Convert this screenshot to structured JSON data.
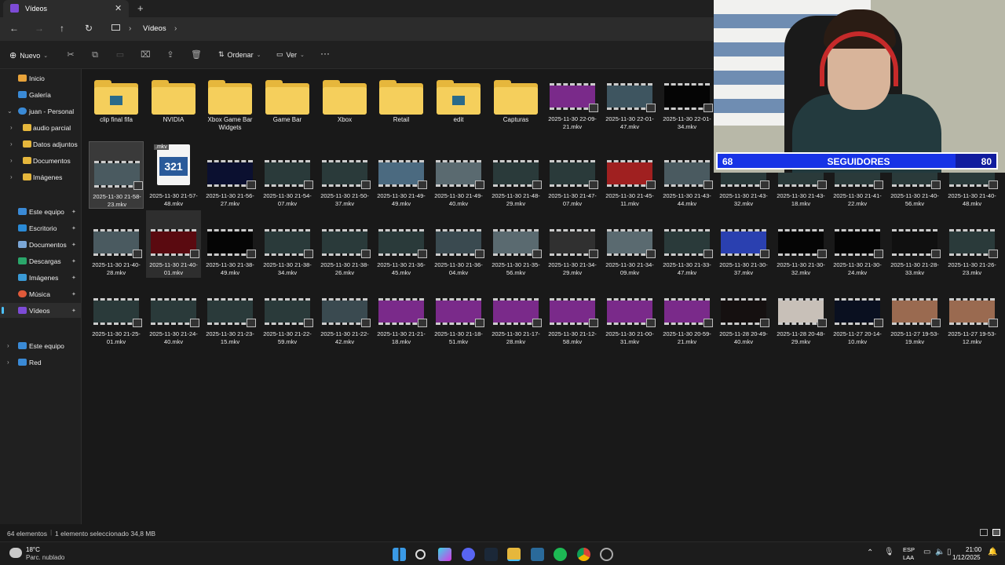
{
  "window": {
    "tab_title": "Vídeos",
    "close": "✕",
    "new_tab": "+"
  },
  "nav": {
    "location": "Vídeos"
  },
  "commands": {
    "new": "Nuevo",
    "sort": "Ordenar",
    "view": "Ver",
    "more": "···"
  },
  "sidebar": {
    "items": [
      {
        "label": "Inicio",
        "icon": "home-icon"
      },
      {
        "label": "Galería",
        "icon": "gallery-icon"
      },
      {
        "label": "juan - Personal",
        "icon": "cloud-icon"
      },
      {
        "label": "audio parcial",
        "icon": "folder-icon"
      },
      {
        "label": "Datos adjuntos",
        "icon": "folder-icon"
      },
      {
        "label": "Documentos",
        "icon": "folder-icon"
      },
      {
        "label": "Imágenes",
        "icon": "folder-icon"
      },
      {
        "label": "Este equipo",
        "icon": "monitor-icon"
      },
      {
        "label": "Escritorio",
        "icon": "desktop-icon"
      },
      {
        "label": "Documentos",
        "icon": "documents-icon"
      },
      {
        "label": "Descargas",
        "icon": "download-icon"
      },
      {
        "label": "Imágenes",
        "icon": "pictures-icon"
      },
      {
        "label": "Música",
        "icon": "music-icon"
      },
      {
        "label": "Vídeos",
        "icon": "videos-icon"
      },
      {
        "label": "Este equipo",
        "icon": "monitor-icon"
      },
      {
        "label": "Red",
        "icon": "network-icon"
      }
    ]
  },
  "folders": [
    {
      "name": "clip final fifa"
    },
    {
      "name": "NVIDIA"
    },
    {
      "name": "Xbox Game Bar Widgets"
    },
    {
      "name": "Game Bar"
    },
    {
      "name": "Xbox"
    },
    {
      "name": "Retail"
    },
    {
      "name": "edit"
    },
    {
      "name": "Capturas"
    }
  ],
  "row1_videos": [
    {
      "name": "2025-11-30 22-09-21.mkv",
      "color": "#7a2a8a"
    },
    {
      "name": "2025-11-30 22-01-47.mkv",
      "color": "#3e5560"
    },
    {
      "name": "2025-11-30 22-01-34.mkv",
      "color": "#050505"
    }
  ],
  "row2_mkv_badge": ".mkv",
  "row2_mkv_icon_text": "321",
  "row2_videos": [
    {
      "name": "2025-11-30 21-58-23.mkv",
      "color": "#4a5a60"
    },
    {
      "name": "2025-11-30 21-57-48.mkv",
      "color": "#ffffff"
    },
    {
      "name": "2025-11-30 21-56-27.mkv",
      "color": "#0b1030"
    },
    {
      "name": "2025-11-30 21-54-07.mkv",
      "color": "#2a3a3a"
    },
    {
      "name": "2025-11-30 21-50-37.mkv",
      "color": "#2a3a3a"
    },
    {
      "name": "2025-11-30 21-49-49.mkv",
      "color": "#4b6a80"
    },
    {
      "name": "2025-11-30 21-49-40.mkv",
      "color": "#5a6a70"
    },
    {
      "name": "2025-11-30 21-48-29.mkv",
      "color": "#2a3a3a"
    },
    {
      "name": "2025-11-30 21-47-07.mkv",
      "color": "#2a3a3a"
    },
    {
      "name": "2025-11-30 21-45-11.mkv",
      "color": "#a02020"
    },
    {
      "name": "2025-11-30 21-43-44.mkv",
      "color": "#4a5a60"
    },
    {
      "name": "2025-11-30 21-43-32.mkv",
      "color": "#2a3a3a"
    },
    {
      "name": "2025-11-30 21-43-18.mkv",
      "color": "#2a3a3a"
    },
    {
      "name": "2025-11-30 21-41-22.mkv",
      "color": "#2a3a3a"
    },
    {
      "name": "2025-11-30 21-40-56.mkv",
      "color": "#2a3a3a"
    },
    {
      "name": "2025-11-30 21-40-48.mkv",
      "color": "#2a3a3a"
    }
  ],
  "row3_videos": [
    {
      "name": "2025-11-30 21-40-28.mkv",
      "color": "#4a5a60"
    },
    {
      "name": "2025-11-30 21-40-01.mkv",
      "color": "#5a0a10"
    },
    {
      "name": "2025-11-30 21-38-49.mkv",
      "color": "#050505"
    },
    {
      "name": "2025-11-30 21-38-34.mkv",
      "color": "#2a3a3a"
    },
    {
      "name": "2025-11-30 21-38-26.mkv",
      "color": "#2a3a3a"
    },
    {
      "name": "2025-11-30 21-36-45.mkv",
      "color": "#2a3a3a"
    },
    {
      "name": "2025-11-30 21-36-04.mkv",
      "color": "#3a4a50"
    },
    {
      "name": "2025-11-30 21-35-56.mkv",
      "color": "#5a6a70"
    },
    {
      "name": "2025-11-30 21-34-29.mkv",
      "color": "#303030"
    },
    {
      "name": "2025-11-30 21-34-09.mkv",
      "color": "#5a6a70"
    },
    {
      "name": "2025-11-30 21-33-47.mkv",
      "color": "#2a3a3a"
    },
    {
      "name": "2025-11-30 21-30-37.mkv",
      "color": "#2a40b0"
    },
    {
      "name": "2025-11-30 21-30-32.mkv",
      "color": "#050505"
    },
    {
      "name": "2025-11-30 21-30-24.mkv",
      "color": "#050505"
    },
    {
      "name": "2025-11-30 21-28-33.mkv",
      "color": "#101010"
    },
    {
      "name": "2025-11-30 21-26-23.mkv",
      "color": "#2a3a3a"
    }
  ],
  "row4_videos": [
    {
      "name": "2025-11-30 21-25-01.mkv",
      "color": "#2a3a3a"
    },
    {
      "name": "2025-11-30 21-24-40.mkv",
      "color": "#2a3a3a"
    },
    {
      "name": "2025-11-30 21-23-15.mkv",
      "color": "#2a3a3a"
    },
    {
      "name": "2025-11-30 21-22-59.mkv",
      "color": "#2a3a3a"
    },
    {
      "name": "2025-11-30 21-22-42.mkv",
      "color": "#3a4a50"
    },
    {
      "name": "2025-11-30 21-21-18.mkv",
      "color": "#7a2a8a"
    },
    {
      "name": "2025-11-30 21-18-51.mkv",
      "color": "#7a2a8a"
    },
    {
      "name": "2025-11-30 21-17-28.mkv",
      "color": "#7a2a8a"
    },
    {
      "name": "2025-11-30 21-12-58.mkv",
      "color": "#7a2a8a"
    },
    {
      "name": "2025-11-30 21-00-31.mkv",
      "color": "#7a2a8a"
    },
    {
      "name": "2025-11-30 20-59-21.mkv",
      "color": "#7a2a8a"
    },
    {
      "name": "2025-11-28 20-49-40.mkv",
      "color": "#151010"
    },
    {
      "name": "2025-11-28 20-48-29.mkv",
      "color": "#c8c0b8"
    },
    {
      "name": "2025-11-27 20-14-10.mkv",
      "color": "#0a1020"
    },
    {
      "name": "2025-11-27 19-53-19.mkv",
      "color": "#9a6a50"
    },
    {
      "name": "2025-11-27 19-53-12.mkv",
      "color": "#9a6a50"
    }
  ],
  "status": {
    "count": "64 elementos",
    "selection": "1 elemento seleccionado  34,8 MB"
  },
  "overlay": {
    "followers_current": "68",
    "label": "SEGUIDORES",
    "followers_goal": "80"
  },
  "taskbar": {
    "weather_temp": "18°C",
    "weather_desc": "Parc. nublado",
    "lang": "ESP",
    "layout": "LAA",
    "time": "21:00",
    "date": "1/12/2025"
  }
}
